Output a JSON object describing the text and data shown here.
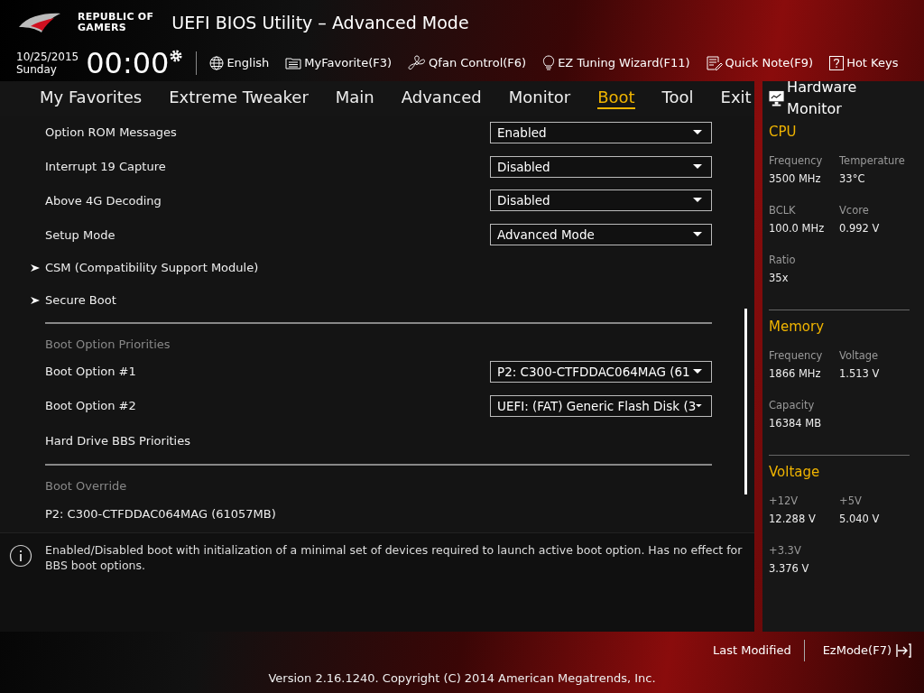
{
  "header": {
    "brand": [
      "REPUBLIC OF",
      "GAMERS"
    ],
    "title": "UEFI BIOS Utility – Advanced Mode"
  },
  "toolbar": {
    "date": "10/25/2015",
    "day": "Sunday",
    "time": "00:00",
    "items": [
      {
        "kind": "globe",
        "label": "English"
      },
      {
        "kind": "favorite",
        "label": "MyFavorite(F3)"
      },
      {
        "kind": "fan",
        "label": "Qfan Control(F6)"
      },
      {
        "kind": "bulb",
        "label": "EZ Tuning Wizard(F11)"
      },
      {
        "kind": "note",
        "label": "Quick Note(F9)"
      },
      {
        "kind": "help",
        "label": "Hot Keys"
      }
    ]
  },
  "tabs": [
    {
      "label": "My Favorites",
      "selected": false
    },
    {
      "label": "Extreme Tweaker",
      "selected": false
    },
    {
      "label": "Main",
      "selected": false
    },
    {
      "label": "Advanced",
      "selected": false
    },
    {
      "label": "Monitor",
      "selected": false
    },
    {
      "label": "Boot",
      "selected": true
    },
    {
      "label": "Tool",
      "selected": false
    },
    {
      "label": "Exit",
      "selected": false
    }
  ],
  "settings": [
    {
      "kind": "dropdown",
      "label": "Option ROM Messages",
      "value": "Enabled"
    },
    {
      "kind": "dropdown",
      "label": "Interrupt 19 Capture",
      "value": "Disabled"
    },
    {
      "kind": "dropdown",
      "label": "Above 4G Decoding",
      "value": "Disabled"
    },
    {
      "kind": "dropdown",
      "label": "Setup Mode",
      "value": "Advanced Mode"
    },
    {
      "kind": "submenu",
      "label": "CSM (Compatibility Support Module)"
    },
    {
      "kind": "submenu",
      "label": "Secure Boot"
    },
    {
      "kind": "heading",
      "label": "Boot Option Priorities"
    },
    {
      "kind": "dropdown",
      "label": "Boot Option #1",
      "value": "P2: C300-CTFDDAC064MAG  (61"
    },
    {
      "kind": "dropdown",
      "label": "Boot Option #2",
      "value": "UEFI: (FAT) Generic Flash Disk (3"
    },
    {
      "kind": "plain",
      "label": "Hard Drive BBS Priorities"
    },
    {
      "kind": "heading",
      "label": "Boot Override"
    },
    {
      "kind": "plain",
      "label": "P2: C300-CTFDDAC064MAG  (61057MB)"
    }
  ],
  "help_text": "Enabled/Disabled boot with initialization of a minimal set of devices required to launch active boot option. Has no effect for BBS boot options.",
  "hardware_monitor": {
    "title": "Hardware Monitor",
    "sections": [
      {
        "title": "CPU",
        "rows": [
          [
            {
              "label": "Frequency",
              "value": "3500 MHz"
            },
            {
              "label": "Temperature",
              "value": "33°C"
            }
          ],
          [
            {
              "label": "BCLK",
              "value": "100.0 MHz"
            },
            {
              "label": "Vcore",
              "value": "0.992 V"
            }
          ],
          [
            {
              "label": "Ratio",
              "value": "35x"
            }
          ]
        ]
      },
      {
        "title": "Memory",
        "rows": [
          [
            {
              "label": "Frequency",
              "value": "1866 MHz"
            },
            {
              "label": "Voltage",
              "value": "1.513 V"
            }
          ],
          [
            {
              "label": "Capacity",
              "value": "16384 MB"
            }
          ]
        ]
      },
      {
        "title": "Voltage",
        "rows": [
          [
            {
              "label": "+12V",
              "value": "12.288 V"
            },
            {
              "label": "+5V",
              "value": "5.040 V"
            }
          ],
          [
            {
              "label": "+3.3V",
              "value": "3.376 V"
            }
          ]
        ]
      }
    ]
  },
  "footer": {
    "last_modified": "Last Modified",
    "ez_mode": "EzMode(F7)",
    "version": "Version 2.16.1240. Copyright (C) 2014 American Megatrends, Inc."
  }
}
